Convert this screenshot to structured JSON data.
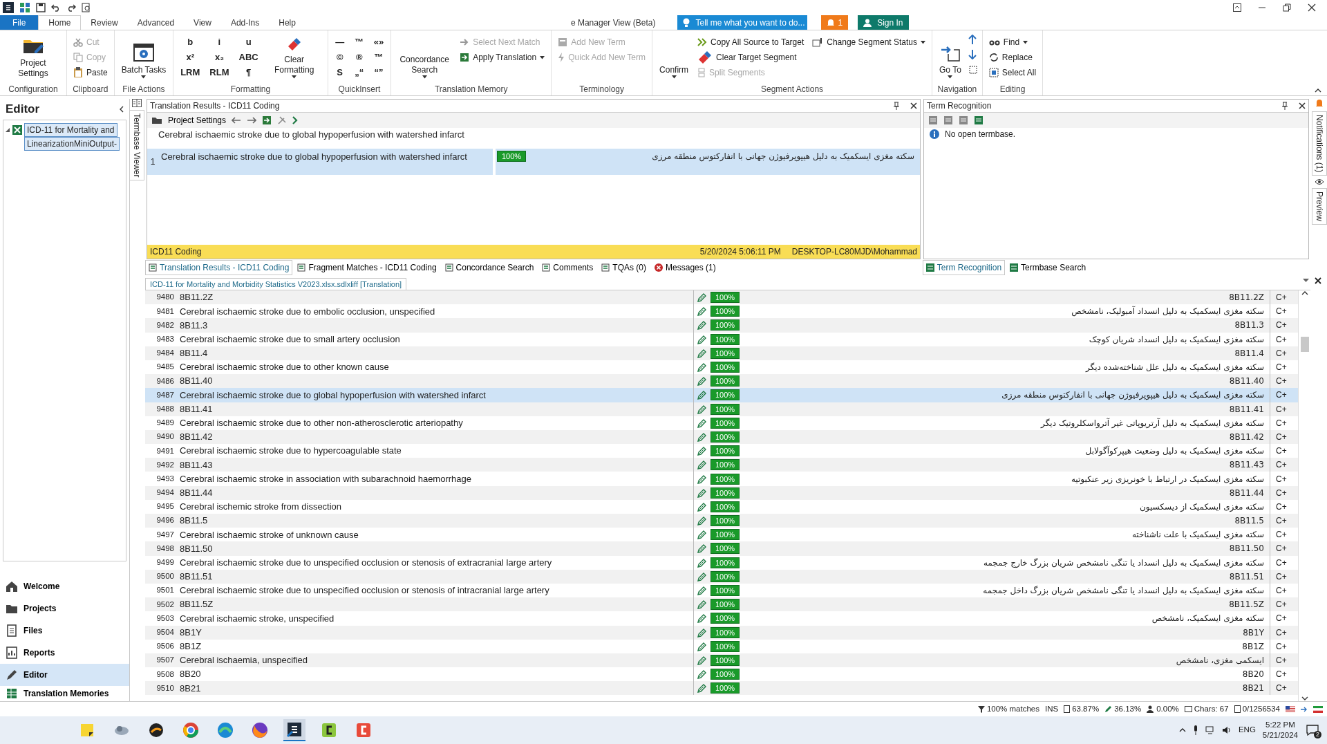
{
  "ribbon": {
    "tabs": [
      {
        "label": "File",
        "kind": "file",
        "selected": false
      },
      {
        "label": "Home",
        "kind": "tab",
        "selected": true
      },
      {
        "label": "Review",
        "kind": "tab",
        "selected": false
      },
      {
        "label": "Advanced",
        "kind": "tab",
        "selected": false
      },
      {
        "label": "View",
        "kind": "tab",
        "selected": false
      },
      {
        "label": "Add-Ins",
        "kind": "tab",
        "selected": false
      },
      {
        "label": "Help",
        "kind": "tab",
        "selected": false
      },
      {
        "label": "e Manager View (Beta)",
        "kind": "tab",
        "selected": false
      }
    ],
    "tell_me": {
      "placeholder": "Tell me what you want to do..."
    },
    "alerts": "1",
    "sign_in": "Sign In",
    "groups": [
      {
        "label": "Configuration",
        "items": [
          {
            "kind": "large",
            "label": "Project Settings"
          }
        ]
      },
      {
        "label": "Clipboard",
        "items": [
          {
            "kind": "small",
            "label": "Cut",
            "disabled": true
          },
          {
            "kind": "small",
            "label": "Copy",
            "disabled": true
          },
          {
            "kind": "small",
            "label": "Paste",
            "disabled": false
          }
        ]
      },
      {
        "label": "File Actions",
        "items": [
          {
            "kind": "large",
            "label": "Batch Tasks",
            "dropdown": true
          }
        ]
      },
      {
        "label": "Formatting",
        "items": [
          {
            "kind": "glyph",
            "label": "b"
          },
          {
            "kind": "glyph",
            "label": "x²"
          },
          {
            "kind": "glyph",
            "label": "LRM"
          },
          {
            "kind": "glyph",
            "label": "i"
          },
          {
            "kind": "glyph",
            "label": "x₂"
          },
          {
            "kind": "glyph",
            "label": "RLM"
          },
          {
            "kind": "glyph",
            "label": "u"
          },
          {
            "kind": "glyph",
            "label": "ABC"
          },
          {
            "kind": "glyph",
            "label": "¶"
          },
          {
            "kind": "large",
            "label": "Clear Formatting",
            "dropdown": true
          }
        ]
      },
      {
        "label": "QuickInsert",
        "items": [
          {
            "kind": "glyph",
            "label": "—"
          },
          {
            "kind": "glyph",
            "label": "©"
          },
          {
            "kind": "glyph",
            "label": "S"
          },
          {
            "kind": "glyph",
            "label": "™"
          },
          {
            "kind": "glyph",
            "label": "®"
          },
          {
            "kind": "glyph",
            "label": "„“"
          },
          {
            "kind": "glyph",
            "label": "«»"
          },
          {
            "kind": "glyph",
            "label": "™"
          },
          {
            "kind": "glyph",
            "label": "“”"
          }
        ]
      },
      {
        "label": "Translation Memory",
        "items": [
          {
            "kind": "large",
            "label": "Concordance Search",
            "dropdown": true
          },
          {
            "kind": "small",
            "label": "Select Next Match",
            "disabled": true
          },
          {
            "kind": "small",
            "label": "Apply Translation",
            "disabled": false,
            "dropdown": true
          }
        ]
      },
      {
        "label": "Terminology",
        "items": [
          {
            "kind": "small",
            "label": "Add New Term",
            "disabled": true
          },
          {
            "kind": "small",
            "label": "Quick Add New Term",
            "disabled": true
          }
        ]
      },
      {
        "label": "Segment Actions",
        "items": [
          {
            "kind": "large",
            "label": "Confirm",
            "dropdown": true
          },
          {
            "kind": "small",
            "label": "Copy All Source to Target",
            "disabled": false
          },
          {
            "kind": "small",
            "label": "Clear Target Segment",
            "disabled": false
          },
          {
            "kind": "small",
            "label": "Split Segments",
            "disabled": true
          },
          {
            "kind": "small",
            "label": "Change Segment Status",
            "disabled": false,
            "dropdown": true
          }
        ]
      },
      {
        "label": "Navigation",
        "items": [
          {
            "kind": "large",
            "label": "Go To",
            "dropdown": true
          }
        ]
      },
      {
        "label": "Editing",
        "items": [
          {
            "kind": "small",
            "label": "Find",
            "disabled": false,
            "dropdown": true
          },
          {
            "kind": "small",
            "label": "Replace",
            "disabled": false
          },
          {
            "kind": "small",
            "label": "Select All",
            "disabled": false
          }
        ]
      }
    ]
  },
  "editor_panel": {
    "title": "Editor",
    "tree": [
      {
        "label": "ICD-11 for Mortality and",
        "expanded": true,
        "children": [
          {
            "label": "LinearizationMiniOutput-"
          }
        ]
      }
    ],
    "nav": [
      {
        "label": "Welcome",
        "selected": false
      },
      {
        "label": "Projects",
        "selected": false
      },
      {
        "label": "Files",
        "selected": false
      },
      {
        "label": "Reports",
        "selected": false
      },
      {
        "label": "Editor",
        "selected": true
      },
      {
        "label": "Translation Memories",
        "selected": false
      }
    ]
  },
  "termbase_viewer_tab": "Termbase Viewer",
  "translation_results": {
    "title": "Translation Results - ICD11 Coding",
    "toolbar_button": "Project Settings",
    "source_preview": "Cerebral ischaemic stroke due to global hypoperfusion with watershed infarct",
    "match": {
      "number": "1",
      "source": "Cerebral ischaemic stroke due to global hypoperfusion with watershed infarct",
      "score": "100%",
      "target": "سکته مغزی ایسکمیک به دلیل هیپوپرفیوژن جهانی با انفارکتوس منطقه مرزی"
    },
    "footer": {
      "provider": "ICD11 Coding",
      "date": "5/20/2024 5:06:11 PM",
      "user": "DESKTOP-LC80MJD\\Mohammad"
    }
  },
  "term_recognition": {
    "title": "Term Recognition",
    "message": "No open termbase."
  },
  "side_tabs": [
    "Notifications (1)",
    "Preview"
  ],
  "lower_tabs": [
    {
      "label": "Translation Results - ICD11 Coding",
      "selected": true
    },
    {
      "label": "Fragment Matches - ICD11 Coding",
      "selected": false
    },
    {
      "label": "Concordance Search",
      "selected": false
    },
    {
      "label": "Comments",
      "selected": false
    },
    {
      "label": "TQAs (0)",
      "selected": false
    },
    {
      "label": "Messages (1)",
      "selected": false
    }
  ],
  "term_tabs": [
    {
      "label": "Term Recognition",
      "selected": true
    },
    {
      "label": "Termbase Search",
      "selected": false
    }
  ],
  "document": {
    "tab": "ICD-11 for Mortality and Morbidity Statistics V2023.xlsx.sdlxliff [Translation]",
    "rows": [
      {
        "number": "9480",
        "source": "8B11.2Z",
        "match": "100%",
        "target": "8B11.2Z",
        "status": "C+",
        "selected": false
      },
      {
        "number": "9481",
        "source": "Cerebral ischaemic stroke due to embolic occlusion, unspecified",
        "match": "100%",
        "target": "سکته مغزی ایسکمیک به دلیل انسداد آمبولیک، نامشخص",
        "status": "C+",
        "selected": false
      },
      {
        "number": "9482",
        "source": "8B11.3",
        "match": "100%",
        "target": "8B11.3",
        "status": "C+",
        "selected": false
      },
      {
        "number": "9483",
        "source": "Cerebral ischaemic stroke due to small artery occlusion",
        "match": "100%",
        "target": "سکته مغزی ایسکمیک به دلیل انسداد شریان کوچک",
        "status": "C+",
        "selected": false
      },
      {
        "number": "9484",
        "source": "8B11.4",
        "match": "100%",
        "target": "8B11.4",
        "status": "C+",
        "selected": false
      },
      {
        "number": "9485",
        "source": "Cerebral ischaemic stroke due to other known cause",
        "match": "100%",
        "target": "سکته مغزی ایسکمیک به دلیل علل شناخته‌شده دیگر",
        "status": "C+",
        "selected": false
      },
      {
        "number": "9486",
        "source": "8B11.40",
        "match": "100%",
        "target": "8B11.40",
        "status": "C+",
        "selected": false
      },
      {
        "number": "9487",
        "source": "Cerebral ischaemic stroke due to global hypoperfusion with watershed infarct",
        "match": "100%",
        "target": "سکته مغزی ایسکمیک به دلیل هیپوپرفیوژن جهانی با انفارکتوس منطقه مرزی",
        "status": "C+",
        "selected": true
      },
      {
        "number": "9488",
        "source": "8B11.41",
        "match": "100%",
        "target": "8B11.41",
        "status": "C+",
        "selected": false
      },
      {
        "number": "9489",
        "source": "Cerebral ischaemic stroke due to other non-atherosclerotic arteriopathy",
        "match": "100%",
        "target": "سکته مغزی ایسکمیک به دلیل آرتریوپاتی غیر آترواسکلروتیک دیگر",
        "status": "C+",
        "selected": false
      },
      {
        "number": "9490",
        "source": "8B11.42",
        "match": "100%",
        "target": "8B11.42",
        "status": "C+",
        "selected": false
      },
      {
        "number": "9491",
        "source": "Cerebral ischaemic stroke due to hypercoagulable state",
        "match": "100%",
        "target": "سکته مغزی ایسکمیک به دلیل وضعیت هیپرکوآگولابل",
        "status": "C+",
        "selected": false
      },
      {
        "number": "9492",
        "source": "8B11.43",
        "match": "100%",
        "target": "8B11.43",
        "status": "C+",
        "selected": false
      },
      {
        "number": "9493",
        "source": "Cerebral ischaemic stroke in association with subarachnoid haemorrhage",
        "match": "100%",
        "target": "سکته مغزی ایسکمیک در ارتباط با خونریزی زیر عنکبوتیه",
        "status": "C+",
        "selected": false
      },
      {
        "number": "9494",
        "source": "8B11.44",
        "match": "100%",
        "target": "8B11.44",
        "status": "C+",
        "selected": false
      },
      {
        "number": "9495",
        "source": "Cerebral ischemic stroke from dissection",
        "match": "100%",
        "target": "سکته مغزی ایسکمیک از دیسکسیون",
        "status": "C+",
        "selected": false
      },
      {
        "number": "9496",
        "source": "8B11.5",
        "match": "100%",
        "target": "8B11.5",
        "status": "C+",
        "selected": false
      },
      {
        "number": "9497",
        "source": "Cerebral ischaemic stroke of unknown cause",
        "match": "100%",
        "target": "سکته مغزی ایسکمیک با علت ناشناخته",
        "status": "C+",
        "selected": false
      },
      {
        "number": "9498",
        "source": "8B11.50",
        "match": "100%",
        "target": "8B11.50",
        "status": "C+",
        "selected": false
      },
      {
        "number": "9499",
        "source": "Cerebral ischaemic stroke due to unspecified occlusion or stenosis of extracranial large artery",
        "match": "100%",
        "target": "سکته مغزی ایسکمیک به دلیل انسداد یا تنگی نامشخص شریان بزرگ خارج جمجمه",
        "status": "C+",
        "selected": false
      },
      {
        "number": "9500",
        "source": "8B11.51",
        "match": "100%",
        "target": "8B11.51",
        "status": "C+",
        "selected": false
      },
      {
        "number": "9501",
        "source": "Cerebral ischaemic stroke due to unspecified occlusion or stenosis of intracranial large artery",
        "match": "100%",
        "target": "سکته مغزی ایسکمیک به دلیل انسداد یا تنگی نامشخص شریان بزرگ داخل جمجمه",
        "status": "C+",
        "selected": false
      },
      {
        "number": "9502",
        "source": "8B11.5Z",
        "match": "100%",
        "target": "8B11.5Z",
        "status": "C+",
        "selected": false
      },
      {
        "number": "9503",
        "source": "Cerebral ischaemic stroke, unspecified",
        "match": "100%",
        "target": "سکته مغزی ایسکمیک، نامشخص",
        "status": "C+",
        "selected": false
      },
      {
        "number": "9504",
        "source": "8B1Y",
        "match": "100%",
        "target": "8B1Y",
        "status": "C+",
        "selected": false
      },
      {
        "number": "9506",
        "source": "8B1Z",
        "match": "100%",
        "target": "8B1Z",
        "status": "C+",
        "selected": false
      },
      {
        "number": "9507",
        "source": "Cerebral ischaemia, unspecified",
        "match": "100%",
        "target": "ایسکمی مغزی، نامشخص",
        "status": "C+",
        "selected": false
      },
      {
        "number": "9508",
        "source": "8B20",
        "match": "100%",
        "target": "8B20",
        "status": "C+",
        "selected": false
      },
      {
        "number": "9510",
        "source": "8B21",
        "match": "100%",
        "target": "8B21",
        "status": "C+",
        "selected": false
      }
    ]
  },
  "status_bar": {
    "filter": "100% matches",
    "mode": "INS",
    "translated": "63.87%",
    "draft": "36.13%",
    "not_translated": "0.00%",
    "chars": "Chars: 67",
    "words": "0/1256534"
  },
  "taskbar": {
    "language": "ENG",
    "time": "5:22 PM",
    "date": "5/21/2024",
    "notifications": "2"
  }
}
